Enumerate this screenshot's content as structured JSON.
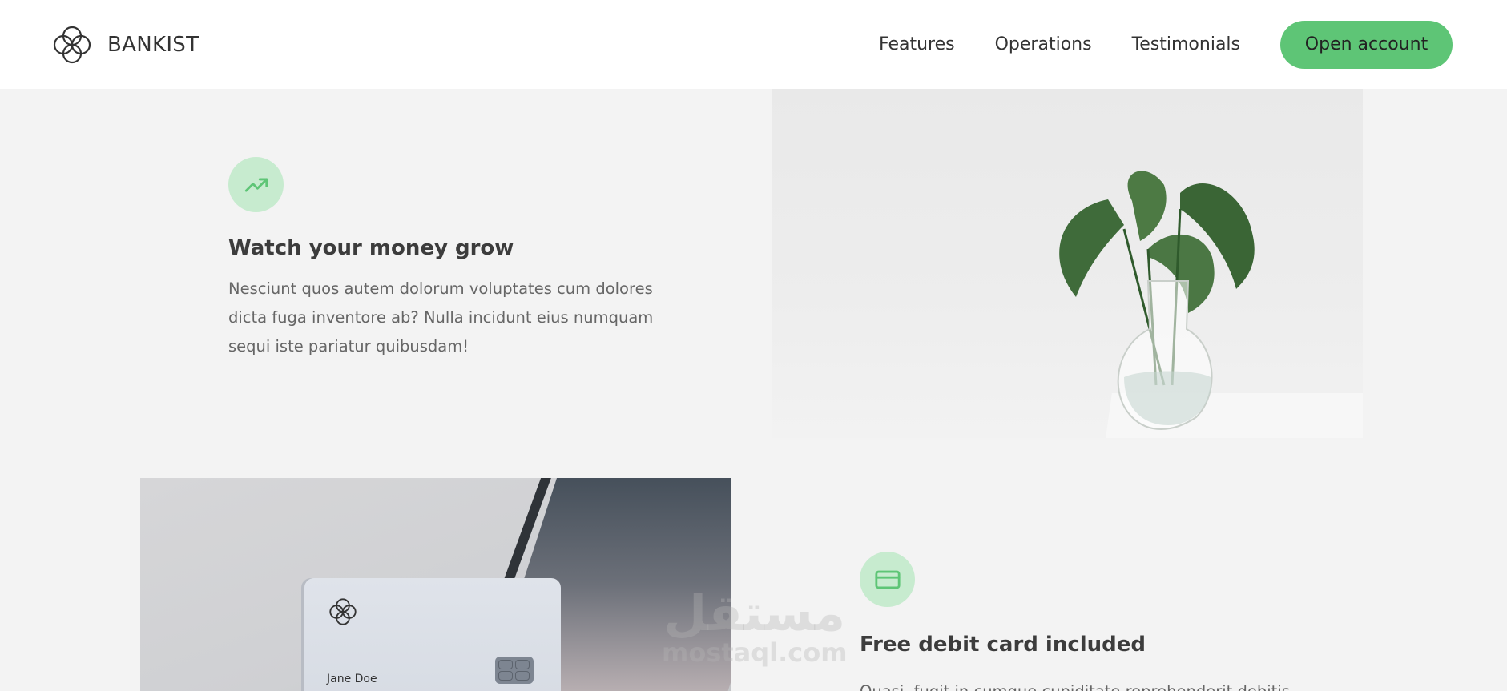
{
  "nav": {
    "logo_text": "BANKIST",
    "links": [
      "Features",
      "Operations",
      "Testimonials"
    ],
    "cta": "Open account"
  },
  "features": [
    {
      "icon": "trending-up-icon",
      "title": "Watch your money grow",
      "description": "Nesciunt quos autem dolorum voluptates cum dolores dicta fuga inventore ab? Nulla incidunt eius numquam sequi iste pariatur quibusdam!"
    },
    {
      "icon": "credit-card-icon",
      "title": "Free debit card included",
      "description": "Quasi, fugit in cumque cupiditate reprehenderit debitis"
    }
  ],
  "card": {
    "holder_name": "Jane Doe"
  },
  "watermark": {
    "arabic": "مستقل",
    "latin": "mostaql.com"
  },
  "colors": {
    "accent": "#5ec576",
    "icon_bg": "#c7ebcf",
    "page_bg": "#f3f3f3"
  }
}
